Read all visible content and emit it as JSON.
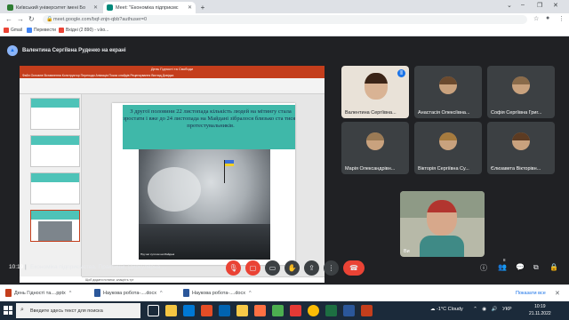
{
  "browser": {
    "tabs": [
      {
        "title": "Київський університет імені Бо",
        "favicon_color": "#2e7d32",
        "active": false
      },
      {
        "title": "Meet: \"Економіка підприємс",
        "favicon_color": "#00897b",
        "active": true
      }
    ],
    "new_tab": "+",
    "url": "meet.google.com/bqf-znjn-qbb?authuser=0",
    "bookmarks": [
      {
        "label": "Gmail",
        "color": "#ea4335"
      },
      {
        "label": "Перевести",
        "color": "#4285f4"
      },
      {
        "label": "Вхідні (2 890) - v.ko...",
        "color": "#ea4335"
      }
    ]
  },
  "meet": {
    "presenter_label": "Валентина Сергіївна Руденко на екрані",
    "shared_screen": {
      "window_title": "День Гідності та Свободи",
      "menu": "Файл   Основне   Вставлення   Конструктор   Переходи   Анімація   Показ слайдів   Рецензування   Вигляд   Довідка",
      "slide_text": "З другої половини 22 листопада кількість людей на мітингу стала зростати і вже до 24 листопада на Майдані зібралося близько ста тисяч протестувальників.",
      "photo_credit": "Під час сутичок на Майдані",
      "notes": "Щоб додати нотатки, клацніть тут",
      "thumb_numbers": [
        "5",
        "6",
        "7",
        "8"
      ]
    },
    "participants": [
      {
        "name": "Валентина Сергіївна...",
        "speaking": true
      },
      {
        "name": "Анастасія Олексіївна..."
      },
      {
        "name": "Софія Сергіївна Григ..."
      },
      {
        "name": "Марія Олександрівн..."
      },
      {
        "name": "Вікторія Сергіївна Су..."
      },
      {
        "name": "Єлизавета Вікторівн..."
      },
      {
        "name": "Ви"
      }
    ],
    "bottom": {
      "time": "10:19",
      "separator": "|",
      "meeting_title": "Економіка підприємства. Практичні. Циркулярна ...",
      "participants_count": "8"
    }
  },
  "downloads": {
    "items": [
      "День Гідності та....pptx",
      "Наукова робота-....docx",
      "Наукова робота-....docx"
    ],
    "show_all": "Показати все"
  },
  "taskbar": {
    "search_placeholder": "Введите здесь текст для поиска",
    "weather": "-1°C  Cloudy",
    "lang": "УКР",
    "time": "10:19",
    "date": "21.11.2022"
  }
}
